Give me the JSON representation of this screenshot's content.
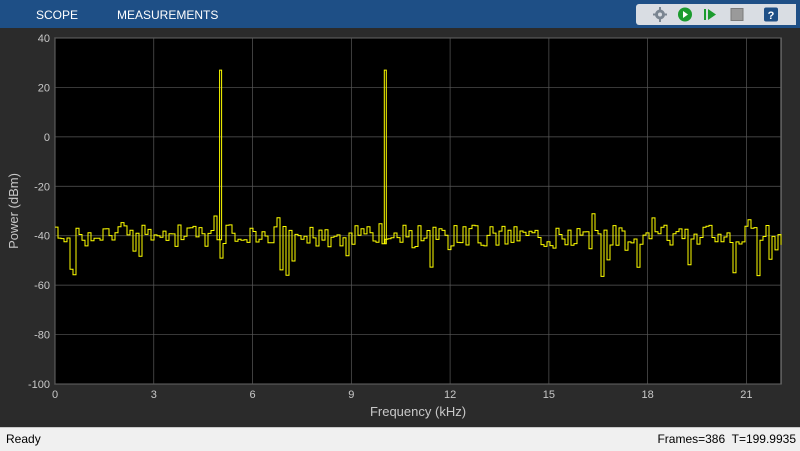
{
  "toolstrip": {
    "tabs": [
      {
        "label": "SCOPE"
      },
      {
        "label": "MEASUREMENTS"
      }
    ],
    "buttons": [
      {
        "name": "settings-icon",
        "label": "Settings"
      },
      {
        "name": "run-icon",
        "label": "Run"
      },
      {
        "name": "step-forward-icon",
        "label": "Step Forward"
      },
      {
        "name": "stop-icon",
        "label": "Stop"
      },
      {
        "name": "help-icon",
        "label": "?"
      }
    ]
  },
  "status": {
    "state": "Ready",
    "frames_label": "Frames=386",
    "time_label": "T=199.9935"
  },
  "colors": {
    "toolstrip_bg": "#1e4f86",
    "plot_bg": "#000000",
    "frame_bg": "#2b2b2b",
    "grid": "#5a5a5a",
    "trace": "#ffff00",
    "axis_text": "#c8c8c8"
  },
  "chart_data": {
    "type": "line",
    "title": "",
    "xlabel": "Frequency (kHz)",
    "ylabel": "Power (dBm)",
    "xlim": [
      0,
      22.05
    ],
    "ylim": [
      -100,
      40
    ],
    "xticks": [
      0,
      3,
      6,
      9,
      12,
      15,
      18,
      21
    ],
    "yticks": [
      40,
      20,
      0,
      -20,
      -40,
      -60,
      -80,
      -100
    ],
    "grid": true,
    "series": [
      {
        "color": "#ffff00",
        "noise_floor_dbm": -40,
        "peaks": [
          {
            "x": 5.0,
            "y": 27
          },
          {
            "x": 10.0,
            "y": 27
          }
        ]
      }
    ]
  }
}
